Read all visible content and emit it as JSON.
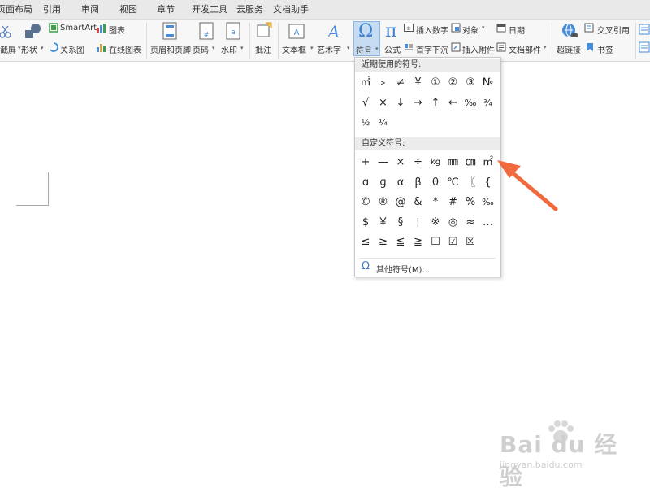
{
  "menu": {
    "tabs": [
      "页面布局",
      "引用",
      "审阅",
      "视图",
      "章节",
      "开发工具",
      "云服务",
      "文档助手"
    ]
  },
  "ribbon": {
    "screenshot_label": "截屏",
    "shapes_label": "形状",
    "smartart_label": "SmartArt",
    "chart_label": "图表",
    "relation_label": "关系图",
    "online_chart_label": "在线图表",
    "header_footer_label": "页眉和页脚",
    "page_number_label": "页码",
    "watermark_label": "水印",
    "comment_label": "批注",
    "textbox_label": "文本框",
    "wordart_label": "艺术字",
    "symbol_label": "符号",
    "formula_label": "公式",
    "insert_number_label": "插入数字",
    "dropcap_label": "首字下沉",
    "object_label": "对象",
    "attachment_label": "插入附件",
    "date_label": "日期",
    "doc_parts_label": "文档部件",
    "hyperlink_label": "超链接",
    "crossref_label": "交叉引用",
    "bookmark_label": "书签"
  },
  "symbol_panel": {
    "recent_title": "近期使用的符号:",
    "recent_symbols": [
      "㎡",
      "﹥",
      "≠",
      "¥",
      "①",
      "②",
      "③",
      "№",
      "√",
      "×",
      "↓",
      "→",
      "↑",
      "←",
      "‰",
      "¾",
      "½",
      "¼"
    ],
    "custom_title": "自定义符号:",
    "custom_symbols": [
      "+",
      "—",
      "×",
      "÷",
      "kg",
      "㎜",
      "㎝",
      "㎡",
      "ɑ",
      "ɡ",
      "α",
      "β",
      "θ",
      "℃",
      "〖",
      "{",
      "©",
      "®",
      "@",
      "&",
      "*",
      "#",
      "%",
      "‰",
      "$",
      "￥",
      "§",
      "¦",
      "※",
      "◎",
      "≈",
      "…",
      "≤",
      "≥",
      "≦",
      "≧",
      "☐",
      "☑",
      "☒"
    ],
    "more_label": "其他符号(M)..."
  },
  "colors": {
    "accent_arrow": "#f06a3e",
    "symbol_highlight": "#c6dcf3"
  },
  "watermark": {
    "logo": "Bai du 经验",
    "url": "jingyan.baidu.com"
  }
}
